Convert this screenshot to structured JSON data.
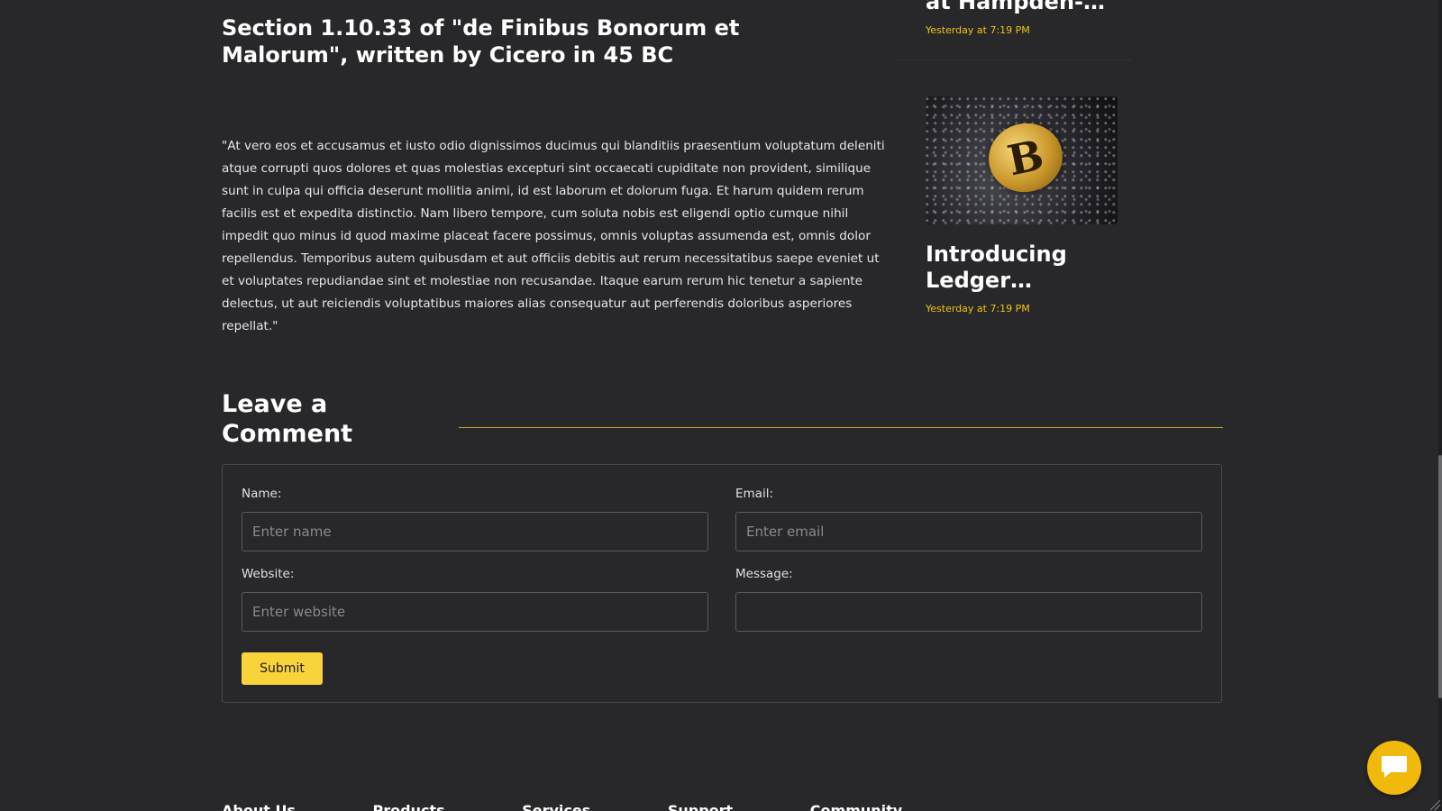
{
  "article": {
    "title": "Section 1.10.33 of \"de Finibus Bonorum et Malorum\", written by Cicero in 45 BC",
    "body": "\"At vero eos et accusamus et iusto odio dignissimos ducimus qui blanditiis praesentium voluptatum deleniti atque corrupti quos dolores et quas molestias excepturi sint occaecati cupiditate non provident, similique sunt in culpa qui officia deserunt mollitia animi, id est laborum et dolorum fuga. Et harum quidem rerum facilis est et expedita distinctio. Nam libero tempore, cum soluta nobis est eligendi optio cumque nihil impedit quo minus id quod maxime placeat facere possimus, omnis voluptas assumenda est, omnis dolor repellendus. Temporibus autem quibusdam et aut officiis debitis aut rerum necessitatibus saepe eveniet ut et voluptates repudiandae sint et molestiae non recusandae. Itaque earum rerum hic tenetur a sapiente delectus, ut aut reiciendis voluptatibus maiores alias consequatur aut perferendis doloribus asperiores repellat.\""
  },
  "sidebar": {
    "posts": [
      {
        "title": "at Hampden-…",
        "date": "Yesterday at 7:19 PM"
      },
      {
        "title": "Introducing Ledger…",
        "date": "Yesterday at 7:19 PM",
        "image_icon": "bitcoin-coin"
      }
    ]
  },
  "comment": {
    "heading": "Leave a Comment",
    "name_label": "Name:",
    "name_placeholder": "Enter name",
    "email_label": "Email:",
    "email_placeholder": "Enter email",
    "website_label": "Website:",
    "website_placeholder": "Enter website",
    "message_label": "Message:",
    "message_placeholder": "",
    "submit_label": "Submit"
  },
  "footer": {
    "links": [
      "About Us",
      "Products",
      "Services",
      "Support",
      "Community"
    ]
  },
  "colors": {
    "background": "#28282b",
    "accent": "#f8d33a",
    "date": "#f1c40f"
  }
}
